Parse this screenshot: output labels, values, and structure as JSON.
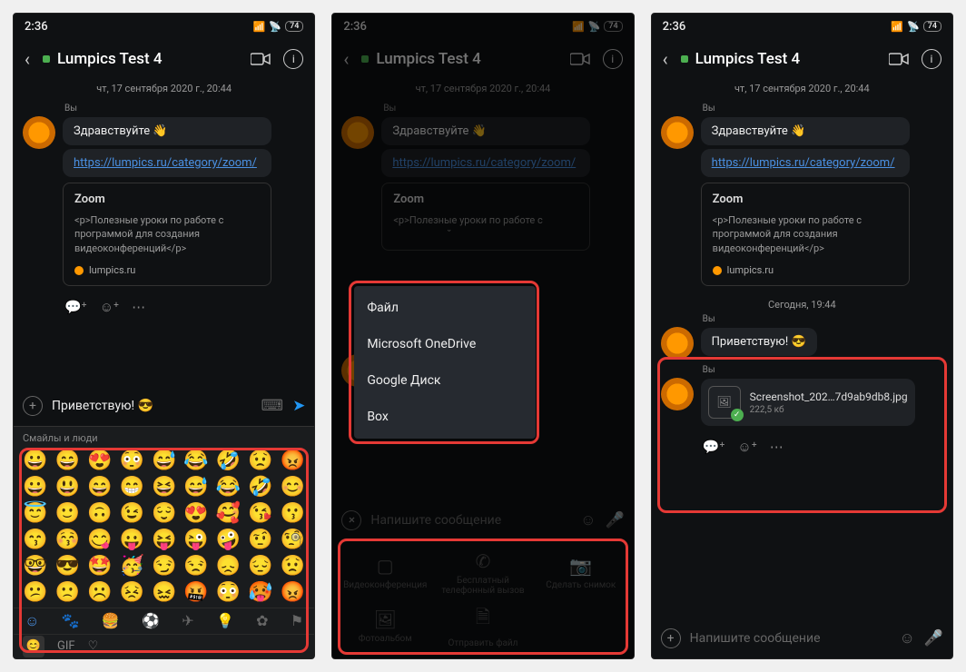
{
  "status": {
    "time": "2:36",
    "battery": "74"
  },
  "header": {
    "title": "Lumpics  Test 4"
  },
  "chat": {
    "date_line": "чт, 17 сентября 2020 г., 20:44",
    "you_label": "Вы",
    "greeting": "Здравствуйте 👋",
    "link_text": "https://lumpics.ru/category/zoom/",
    "card": {
      "title": "Zoom",
      "desc": "<p>Полезные уроки по работе с программой для создания видеоконференций</p>",
      "source": "lumpics.ru"
    }
  },
  "input": {
    "typed": "Приветствую! 😎",
    "placeholder": "Напишите сообщение"
  },
  "keyboard": {
    "category": "Смайлы и люди",
    "emojis": [
      "😀",
      "😄",
      "😍",
      "😳",
      "😅",
      "😂",
      "🤣",
      "😟",
      "😡",
      "😀",
      "😃",
      "😄",
      "😁",
      "😆",
      "😅",
      "😂",
      "🤣",
      "😊",
      "😇",
      "🙂",
      "🙃",
      "😉",
      "😌",
      "😍",
      "🥰",
      "😘",
      "😗",
      "😙",
      "😚",
      "😋",
      "😛",
      "😝",
      "😜",
      "🤪",
      "🤨",
      "🧐",
      "🤓",
      "😎",
      "🤩",
      "🥳",
      "😏",
      "😒",
      "😞",
      "😔",
      "😟",
      "😕",
      "🙁",
      "☹️",
      "😣",
      "😖",
      "🤬",
      "😳",
      "🥵",
      "😡"
    ],
    "gif": "GIF"
  },
  "filemenu": {
    "items": [
      "Файл",
      "Microsoft OneDrive",
      "Google Диск",
      "Box"
    ]
  },
  "attach": {
    "items": [
      "Видеоконференция",
      "Бесплатный телефонный вызов",
      "Сделать снимок",
      "Фотоальбом",
      "Отправить файл",
      ""
    ]
  },
  "today": {
    "label": "Сегодня, 19:44",
    "greet2": "Приветствую! 😎",
    "file_name": "Screenshot_202…7d9ab9db8.jpg",
    "file_size": "222,5 кб"
  }
}
